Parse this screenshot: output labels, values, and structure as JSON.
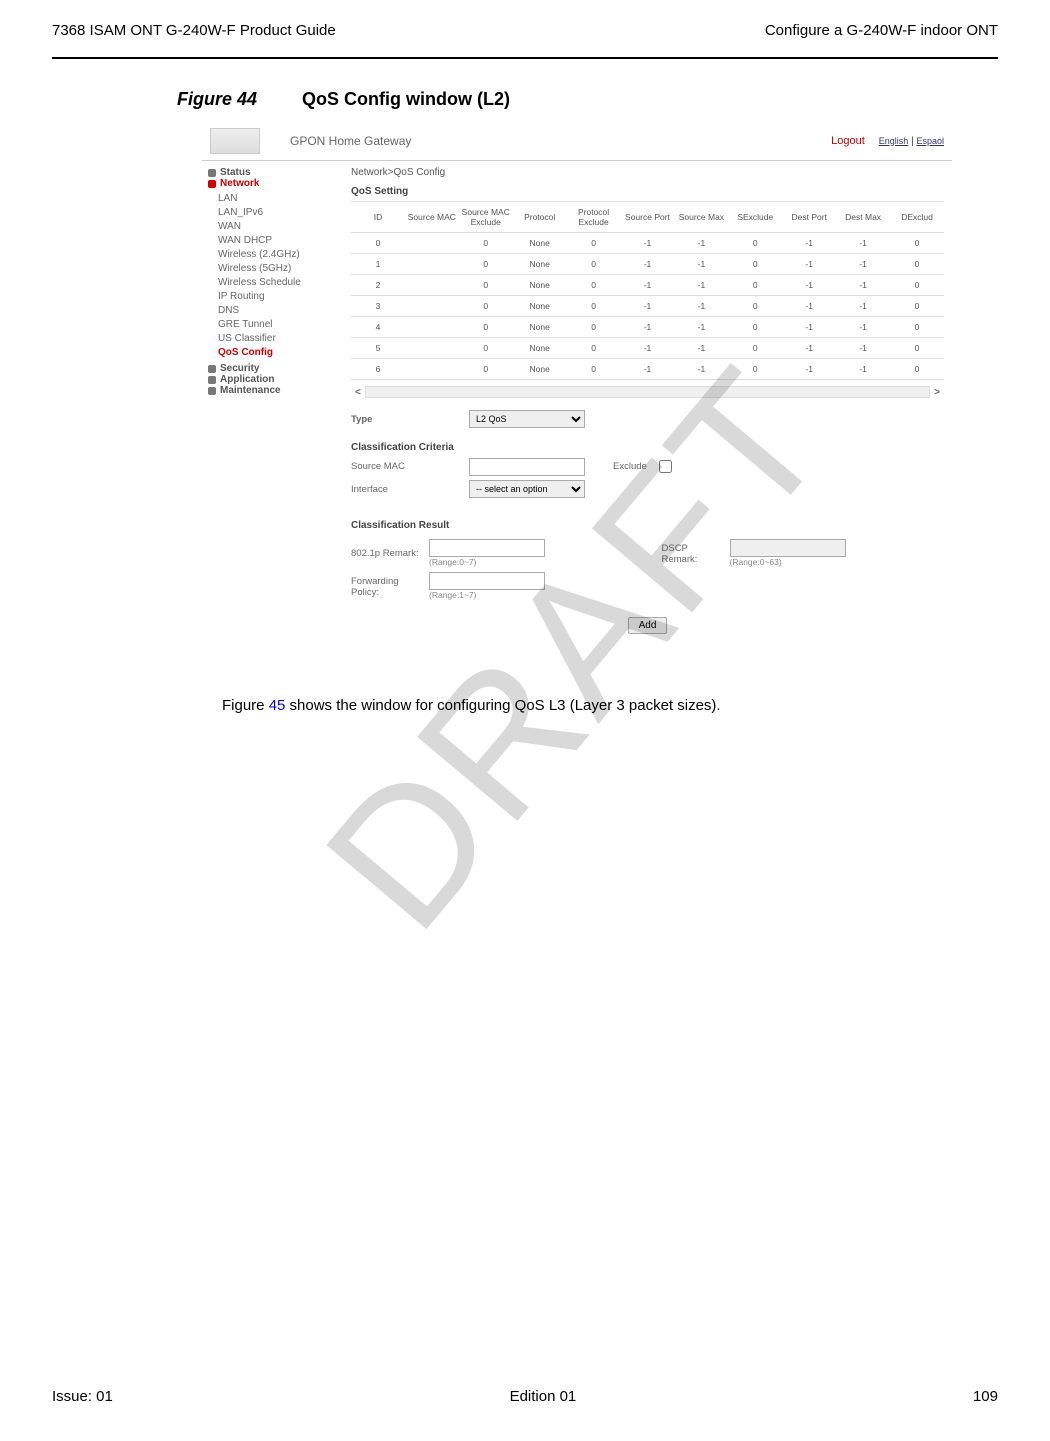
{
  "doc": {
    "header_left": "7368 ISAM ONT G-240W-F Product Guide",
    "header_right": "Configure a G-240W-F indoor ONT",
    "figure_label": "Figure 44",
    "figure_title": "QoS Config window (L2)",
    "body_text_prefix": "Figure ",
    "body_text_link": "45",
    "body_text_suffix": " shows the window for configuring QoS L3 (Layer 3 packet sizes).",
    "watermark": "DRAFT",
    "footer_left": "Issue: 01",
    "footer_center": "Edition 01",
    "footer_right": "109"
  },
  "ui": {
    "header": {
      "title": "GPON Home Gateway",
      "logout": "Logout",
      "lang1": "English",
      "lang_sep": " | ",
      "lang2": "Espaol"
    },
    "breadcrumb": "Network>QoS Config",
    "nav": {
      "status": "Status",
      "network": "Network",
      "items": [
        "LAN",
        "LAN_IPv6",
        "WAN",
        "WAN DHCP",
        "Wireless (2.4GHz)",
        "Wireless (5GHz)",
        "Wireless Schedule",
        "IP Routing",
        "DNS",
        "GRE Tunnel",
        "US Classifier"
      ],
      "active": "QoS Config",
      "security": "Security",
      "application": "Application",
      "maintenance": "Maintenance"
    },
    "qos": {
      "setting_label": "QoS Setting",
      "headers": [
        "ID",
        "Source MAC",
        "Source MAC Exclude",
        "Protocol",
        "Protocol Exclude",
        "Source Port",
        "Source Max",
        "SExclude",
        "Dest Port",
        "Dest Max",
        "DExclud"
      ],
      "rows": [
        [
          "0",
          "",
          "0",
          "None",
          "0",
          "-1",
          "-1",
          "0",
          "-1",
          "-1",
          "0"
        ],
        [
          "1",
          "",
          "0",
          "None",
          "0",
          "-1",
          "-1",
          "0",
          "-1",
          "-1",
          "0"
        ],
        [
          "2",
          "",
          "0",
          "None",
          "0",
          "-1",
          "-1",
          "0",
          "-1",
          "-1",
          "0"
        ],
        [
          "3",
          "",
          "0",
          "None",
          "0",
          "-1",
          "-1",
          "0",
          "-1",
          "-1",
          "0"
        ],
        [
          "4",
          "",
          "0",
          "None",
          "0",
          "-1",
          "-1",
          "0",
          "-1",
          "-1",
          "0"
        ],
        [
          "5",
          "",
          "0",
          "None",
          "0",
          "-1",
          "-1",
          "0",
          "-1",
          "-1",
          "0"
        ],
        [
          "6",
          "",
          "0",
          "None",
          "0",
          "-1",
          "-1",
          "0",
          "-1",
          "-1",
          "0"
        ]
      ],
      "scroll_left": "<",
      "scroll_right": ">"
    },
    "form": {
      "type_label": "Type",
      "type_value": "L2 QoS",
      "cc_label": "Classification Criteria",
      "src_mac_label": "Source MAC",
      "exclude_label": "Exclude",
      "interface_label": "Interface",
      "interface_value": "-- select an option",
      "cr_label": "Classification Result",
      "remark_8021p_label": "802.1p Remark:",
      "remark_8021p_range": "(Range:0~7)",
      "dscp_label": "DSCP Remark:",
      "dscp_range": "(Range:0~63)",
      "fp_label": "Forwarding Policy:",
      "fp_range": "(Range:1~7)",
      "add_label": "Add"
    }
  }
}
